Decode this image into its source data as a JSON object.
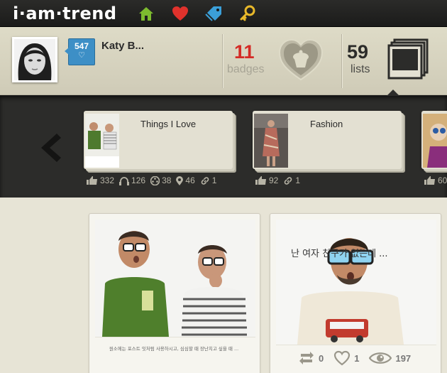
{
  "app": {
    "logo": "i·am·trend"
  },
  "nav": {
    "icons": [
      "home-icon",
      "heart-icon",
      "tag-icon",
      "search-key-icon"
    ]
  },
  "profile": {
    "name": "Katy B...",
    "fan_count": "547",
    "badges_count": "11",
    "badges_label": "badges",
    "lists_count": "59",
    "lists_label": "lists"
  },
  "lists": [
    {
      "title": "Things I Love",
      "stats": {
        "likes": "332",
        "listens": "126",
        "views": "38",
        "places": "46",
        "links": "1"
      }
    },
    {
      "title": "Fashion",
      "stats": {
        "likes": "92",
        "links": "1"
      }
    },
    {
      "title": "",
      "stats": {
        "likes": "60"
      }
    }
  ],
  "posts": [
    {
      "caption": "",
      "description": "원소에는 포스트 잇처럼 사용하시고, 심심할 때 장난치고 싶을 때 ..."
    },
    {
      "caption": "난 여자    친구가 없는데 ...",
      "actions": {
        "reposts": "0",
        "likes": "1",
        "views": "197"
      }
    }
  ],
  "colors": {
    "badges": "#d42b26",
    "fan_badge": "#3d8fc6",
    "topbar": "#222221",
    "band": "#2c2c2a"
  }
}
